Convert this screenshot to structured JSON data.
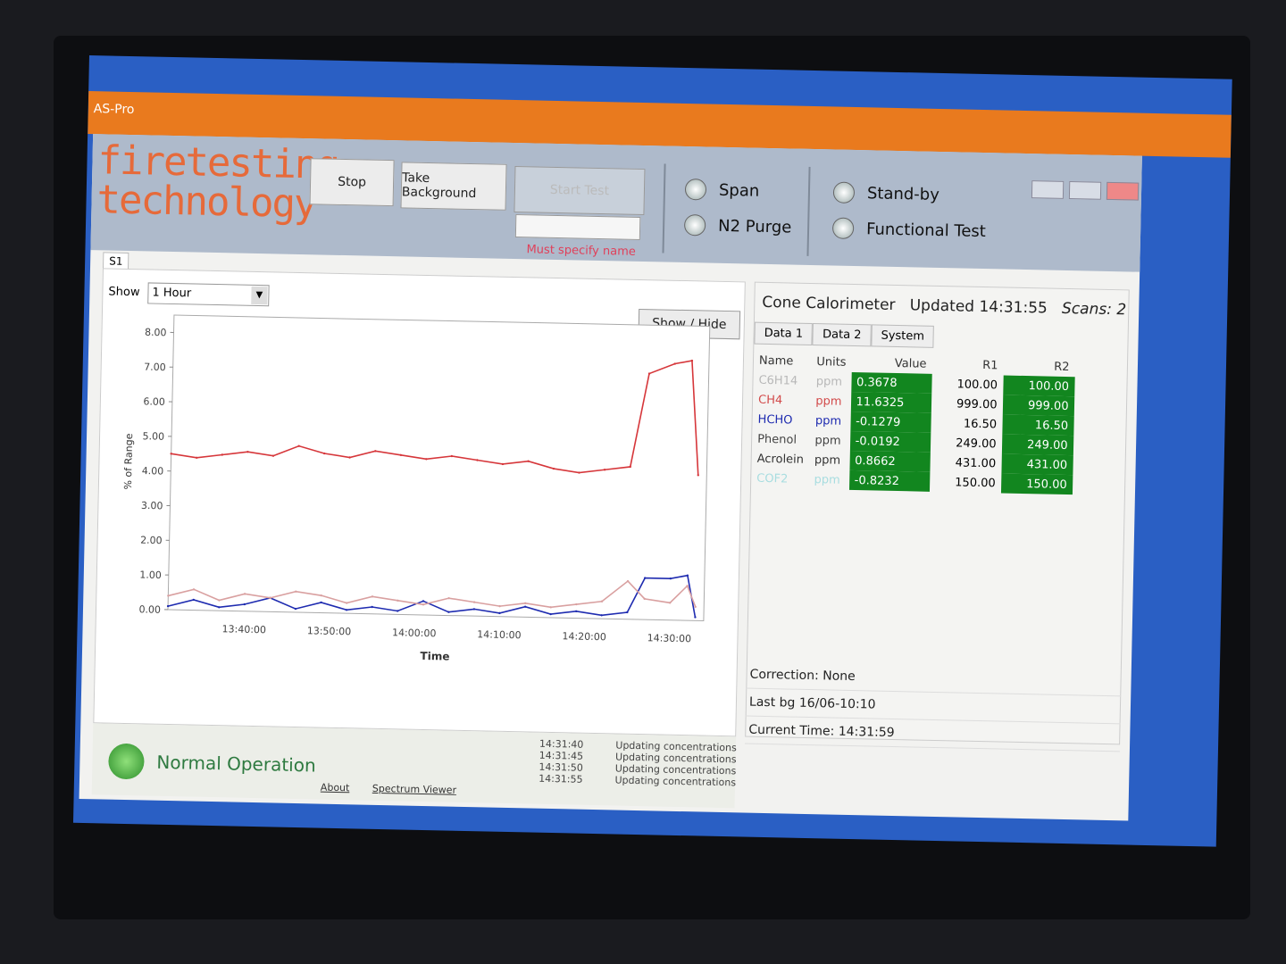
{
  "window": {
    "title": "AS-Pro"
  },
  "logo": {
    "line1": "firetesting",
    "line2": "technology"
  },
  "toolbar": {
    "stop": "Stop",
    "take_background": "Take Background",
    "start_test": "Start Test",
    "name_value": "",
    "warning": "Must specify name"
  },
  "modes": [
    {
      "label": "Span"
    },
    {
      "label": "N2 Purge"
    },
    {
      "label": "Stand-by"
    },
    {
      "label": "Functional Test"
    }
  ],
  "tab": "S1",
  "chart_panel": {
    "show_label": "Show",
    "range": "1 Hour",
    "show_hide": "Show / Hide"
  },
  "chart_data": {
    "type": "line",
    "xlabel": "Time",
    "ylabel": "% of Range",
    "ylim": [
      0,
      8.5
    ],
    "yticks": [
      "0.00",
      "1.00",
      "2.00",
      "3.00",
      "4.00",
      "5.00",
      "6.00",
      "7.00",
      "8.00"
    ],
    "xticks": [
      "13:40:00",
      "13:50:00",
      "14:00:00",
      "14:10:00",
      "14:20:00",
      "14:30:00"
    ],
    "xlim": [
      "13:31",
      "14:34"
    ],
    "x": [
      "13:31",
      "13:34",
      "13:37",
      "13:40",
      "13:43",
      "13:46",
      "13:49",
      "13:52",
      "13:55",
      "13:58",
      "14:01",
      "14:04",
      "14:07",
      "14:10",
      "14:13",
      "14:16",
      "14:19",
      "14:22",
      "14:25",
      "14:27",
      "14:30",
      "14:32",
      "14:33"
    ],
    "series": [
      {
        "color": "#d6363a",
        "values": [
          4.5,
          4.4,
          4.5,
          4.6,
          4.5,
          4.8,
          4.6,
          4.5,
          4.7,
          4.6,
          4.5,
          4.6,
          4.5,
          4.4,
          4.5,
          4.3,
          4.2,
          4.3,
          4.4,
          7.1,
          7.4,
          7.5,
          4.2
        ]
      },
      {
        "color": "#1e2bb0",
        "values": [
          0.1,
          0.3,
          0.1,
          0.2,
          0.4,
          0.1,
          0.3,
          0.1,
          0.2,
          0.1,
          0.4,
          0.1,
          0.2,
          0.1,
          0.3,
          0.1,
          0.2,
          0.1,
          0.2,
          1.2,
          1.2,
          1.3,
          0.1
        ]
      },
      {
        "color": "#d9a0a0",
        "values": [
          0.4,
          0.6,
          0.3,
          0.5,
          0.4,
          0.6,
          0.5,
          0.3,
          0.5,
          0.4,
          0.3,
          0.5,
          0.4,
          0.3,
          0.4,
          0.3,
          0.4,
          0.5,
          1.1,
          0.6,
          0.5,
          1.0,
          0.4
        ]
      }
    ]
  },
  "readings": {
    "title": "Cone Calorimeter",
    "updated": "Updated 14:31:55",
    "scans": "Scans: 2",
    "tabs": [
      "Data 1",
      "Data 2",
      "System"
    ],
    "columns": [
      "Name",
      "Units",
      "Value",
      "R1",
      "R2"
    ],
    "rows": [
      {
        "name": "C6H14",
        "units": "ppm",
        "value": "0.3678",
        "r1": "100.00",
        "r2": "100.00",
        "color": "#b8b8b8"
      },
      {
        "name": "CH4",
        "units": "ppm",
        "value": "11.6325",
        "r1": "999.00",
        "r2": "999.00",
        "color": "#d24a4a"
      },
      {
        "name": "HCHO",
        "units": "ppm",
        "value": "-0.1279",
        "r1": "16.50",
        "r2": "16.50",
        "color": "#1e2bb0"
      },
      {
        "name": "Phenol",
        "units": "ppm",
        "value": "-0.0192",
        "r1": "249.00",
        "r2": "249.00",
        "color": "#444444"
      },
      {
        "name": "Acrolein",
        "units": "ppm",
        "value": "0.8662",
        "r1": "431.00",
        "r2": "431.00",
        "color": "#333333"
      },
      {
        "name": "COF2",
        "units": "ppm",
        "value": "-0.8232",
        "r1": "150.00",
        "r2": "150.00",
        "color": "#a8dde0"
      }
    ],
    "value_bg": "#12861f"
  },
  "info": {
    "correction": "Correction: None",
    "last_bg": "Last bg 16/06-10:10",
    "current_time": "Current Time: 14:31:59"
  },
  "status": {
    "text": "Normal Operation",
    "about": "About",
    "spectrum_viewer": "Spectrum Viewer"
  },
  "log": [
    {
      "time": "14:31:40",
      "msg": "Updating concentrations"
    },
    {
      "time": "14:31:45",
      "msg": "Updating concentrations"
    },
    {
      "time": "14:31:50",
      "msg": "Updating concentrations"
    },
    {
      "time": "14:31:55",
      "msg": "Updating concentrations"
    }
  ]
}
